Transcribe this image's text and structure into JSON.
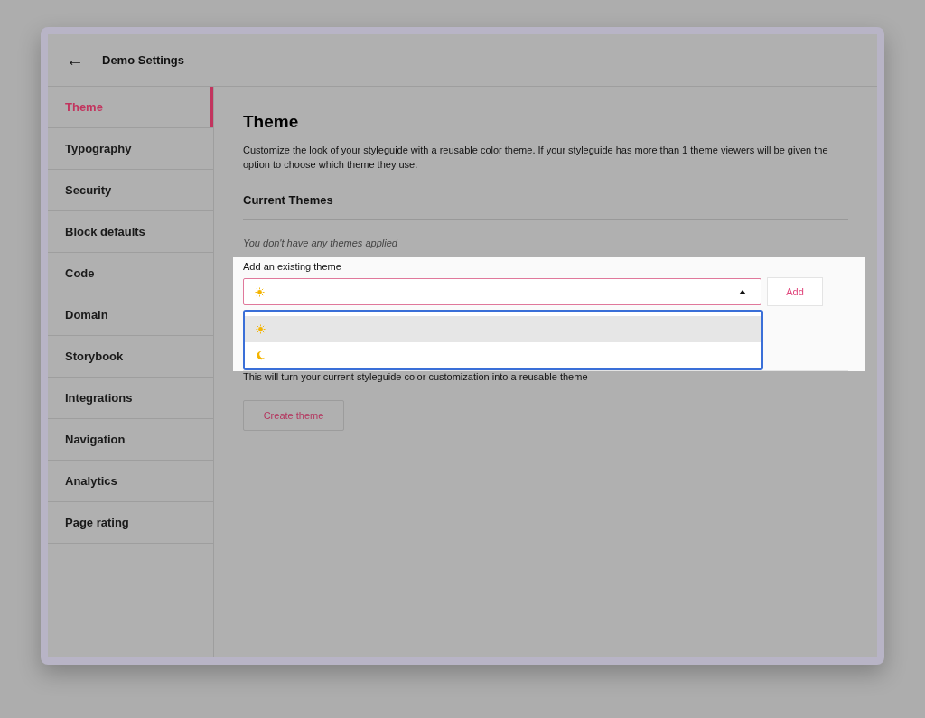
{
  "header": {
    "back": "←",
    "title": "Demo Settings"
  },
  "sidebar": {
    "items": [
      {
        "label": "Theme",
        "selected": true
      },
      {
        "label": "Typography",
        "selected": false
      },
      {
        "label": "Security",
        "selected": false
      },
      {
        "label": "Block defaults",
        "selected": false
      },
      {
        "label": "Code",
        "selected": false
      },
      {
        "label": "Domain",
        "selected": false
      },
      {
        "label": "Storybook",
        "selected": false
      },
      {
        "label": "Integrations",
        "selected": false
      },
      {
        "label": "Navigation",
        "selected": false
      },
      {
        "label": "Analytics",
        "selected": false
      },
      {
        "label": "Page rating",
        "selected": false
      }
    ]
  },
  "content": {
    "title": "Theme",
    "description": "Customize the look of your styleguide with a reusable color theme. If your styleguide has more than 1 theme viewers will be given the option to choose which theme they use.",
    "section_title": "Current Themes",
    "empty_note": "You don't have any themes applied",
    "add_existing": {
      "label": "Add an existing theme",
      "value": {
        "kind": "sun"
      },
      "expanded": true,
      "options": [
        {
          "kind": "sun",
          "selected": true
        },
        {
          "kind": "moon",
          "selected": false
        }
      ],
      "button": "Add"
    },
    "create_note": "This will turn your current styleguide color customization into a reusable theme",
    "create_button": "Create theme"
  }
}
